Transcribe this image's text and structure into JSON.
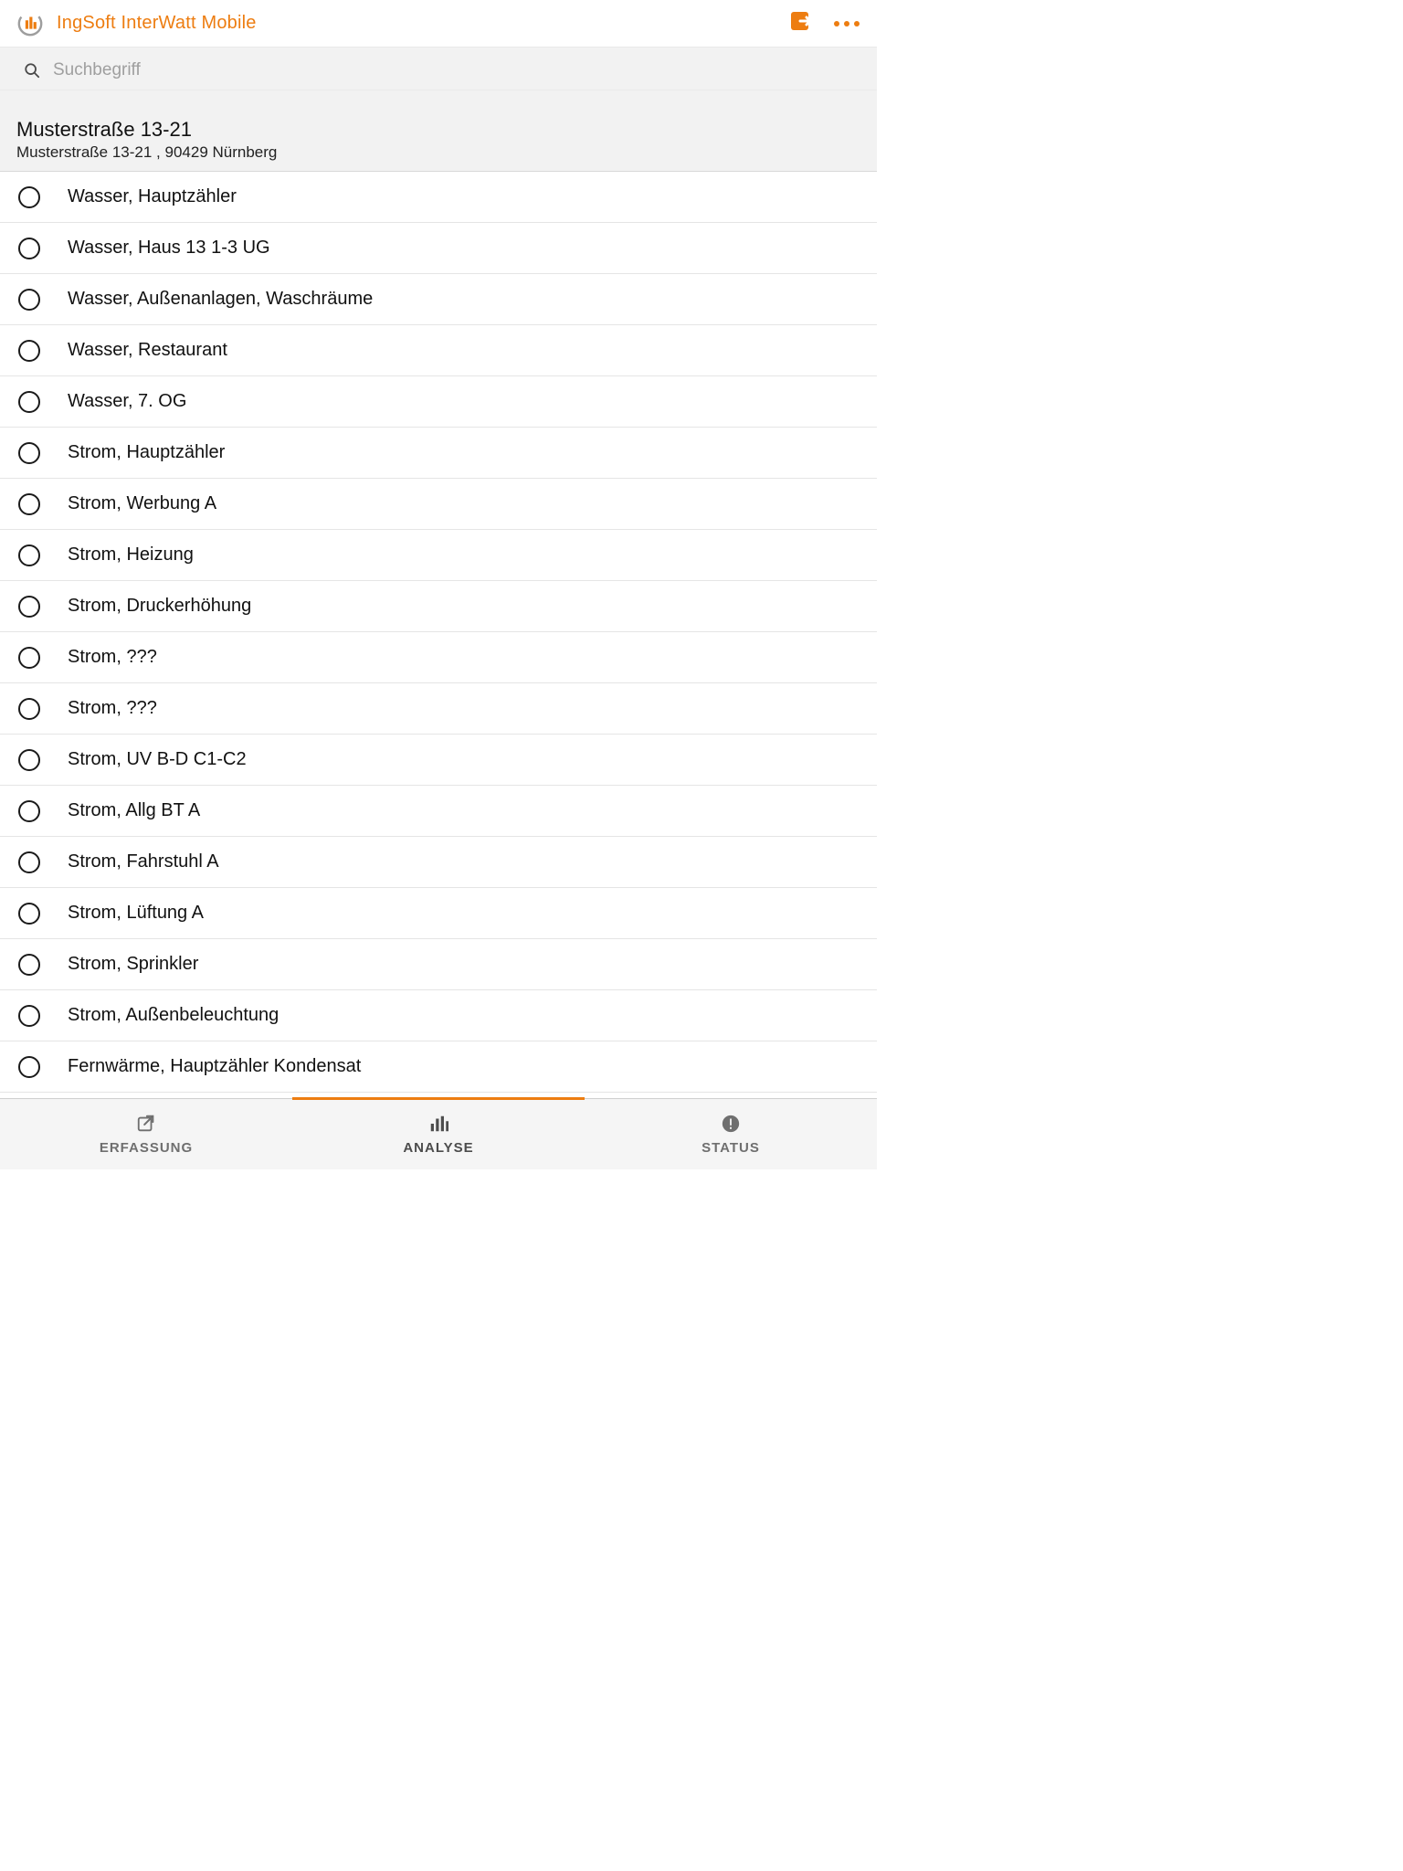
{
  "header": {
    "title": "IngSoft InterWatt Mobile"
  },
  "search": {
    "placeholder": "Suchbegriff",
    "value": ""
  },
  "location": {
    "title": "Musterstraße 13-21",
    "subtitle": "Musterstraße 13-21 , 90429 Nürnberg"
  },
  "meters": [
    {
      "label": "Wasser, Hauptzähler"
    },
    {
      "label": "Wasser, Haus 13 1-3 UG"
    },
    {
      "label": "Wasser, Außenanlagen, Waschräume"
    },
    {
      "label": "Wasser, Restaurant"
    },
    {
      "label": "Wasser, 7. OG"
    },
    {
      "label": "Strom, Hauptzähler"
    },
    {
      "label": "Strom, Werbung A"
    },
    {
      "label": "Strom, Heizung"
    },
    {
      "label": "Strom, Druckerhöhung"
    },
    {
      "label": "Strom, ???"
    },
    {
      "label": "Strom, ???"
    },
    {
      "label": "Strom, UV B-D C1-C2"
    },
    {
      "label": "Strom, Allg BT A"
    },
    {
      "label": "Strom, Fahrstuhl A"
    },
    {
      "label": "Strom, Lüftung A"
    },
    {
      "label": "Strom, Sprinkler"
    },
    {
      "label": "Strom, Außenbeleuchtung"
    },
    {
      "label": "Fernwärme, Hauptzähler Kondensat"
    }
  ],
  "tabs": {
    "erfassung": "ERFASSUNG",
    "analyse": "ANALYSE",
    "status": "STATUS",
    "active": "analyse"
  },
  "colors": {
    "accent": "#ED7D11"
  }
}
